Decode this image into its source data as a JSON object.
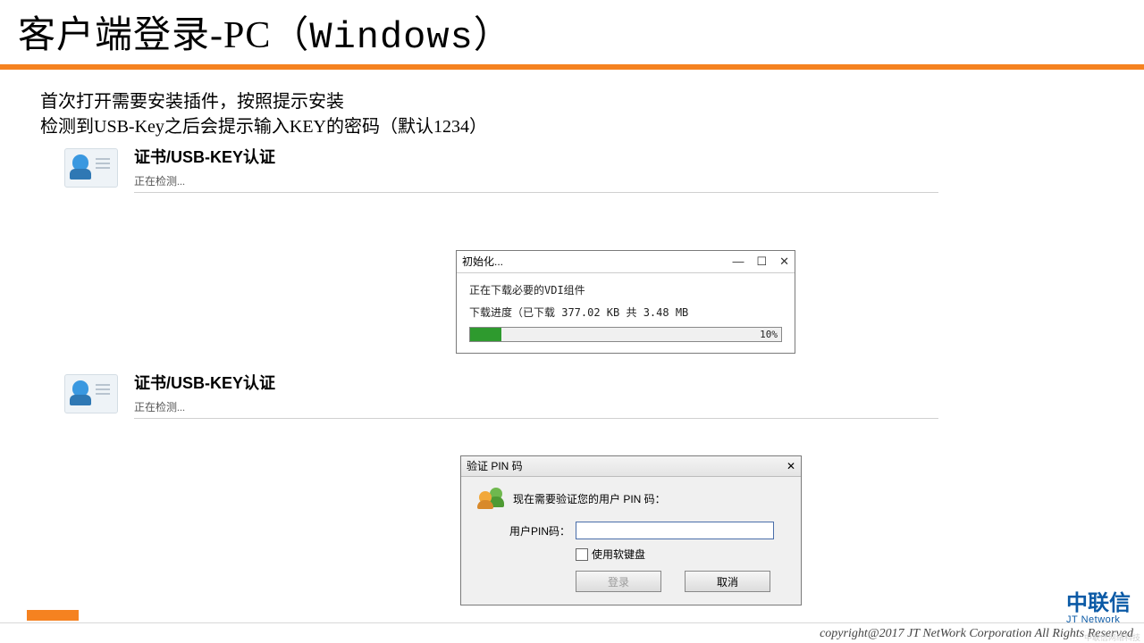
{
  "slide": {
    "title_cn": "客户端登录-PC（",
    "title_platform": "Windows",
    "title_suffix": "）",
    "body_line1": "首次打开需要安装插件，按照提示安装",
    "body_line2": "检测到USB-Key之后会提示输入KEY的密码（默认1234）"
  },
  "cert_panel": {
    "title": "证书/USB-KEY认证",
    "status": "正在检测..."
  },
  "init_dialog": {
    "title": "初始化...",
    "msg": "正在下载必要的VDI组件",
    "progress_text": "下载进度（已下载 377.02 KB 共 3.48 MB",
    "progress_pct": "10%",
    "progress_value": 10
  },
  "pin_dialog": {
    "title": "验证 PIN 码",
    "message": "现在需要验证您的用户 PIN 码：",
    "input_label": "用户PIN码：",
    "input_value": "",
    "soft_keyboard_label": "使用软键盘",
    "login_btn": "登录",
    "cancel_btn": "取消"
  },
  "footer": {
    "copyright": "copyright@2017  JT NetWork Corporation All Rights Reserved",
    "logo_cn": "中联信",
    "logo_en": "JT Network",
    "watermark": "中联信网络科技"
  },
  "win_controls": {
    "min": "—",
    "max": "☐",
    "close": "✕"
  }
}
